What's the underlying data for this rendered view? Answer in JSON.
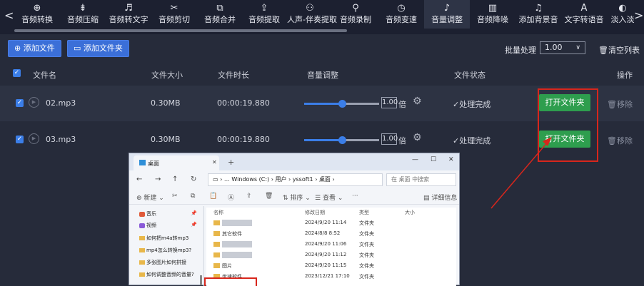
{
  "toolbar": {
    "prev_arrow": "<",
    "next_arrow": ">",
    "tools": [
      {
        "label": "音频转换",
        "icon": "convert-icon",
        "glyph": "⊕"
      },
      {
        "label": "音频压缩",
        "icon": "compress-icon",
        "glyph": "⇟"
      },
      {
        "label": "音频转文字",
        "icon": "speech-to-text-icon",
        "glyph": "♬"
      },
      {
        "label": "音频剪切",
        "icon": "scissors-icon",
        "glyph": "✂"
      },
      {
        "label": "音频合并",
        "icon": "merge-icon",
        "glyph": "⧉"
      },
      {
        "label": "音频提取",
        "icon": "extract-icon",
        "glyph": "⇪"
      },
      {
        "label": "人声-伴奏提取",
        "icon": "vocal-split-icon",
        "glyph": "⚇"
      },
      {
        "label": "音频录制",
        "icon": "microphone-icon",
        "glyph": "⚲"
      },
      {
        "label": "音频变速",
        "icon": "speed-icon",
        "glyph": "◷"
      },
      {
        "label": "音量调整",
        "icon": "volume-icon",
        "glyph": "♪"
      },
      {
        "label": "音频降噪",
        "icon": "denoise-icon",
        "glyph": "▥"
      },
      {
        "label": "添加背景音",
        "icon": "background-music-icon",
        "glyph": "♫"
      },
      {
        "label": "文字转语音",
        "icon": "text-to-speech-icon",
        "glyph": "A"
      },
      {
        "label": "淡入淡",
        "icon": "fade-icon",
        "glyph": "◐"
      }
    ],
    "active_index": 9
  },
  "actions": {
    "add_file": "添加文件",
    "add_folder": "添加文件夹",
    "batch_label": "批量处理",
    "batch_value": "1.00",
    "clear_list": "清空列表"
  },
  "table": {
    "headers": {
      "name": "文件名",
      "size": "文件大小",
      "duration": "文件时长",
      "volume": "音量调整",
      "status": "文件状态",
      "operation": "操作"
    },
    "rows": [
      {
        "name": "02.mp3",
        "size": "0.30MB",
        "duration": "00:00:19.880",
        "volume": "1.00",
        "volume_level": 0.5,
        "unit": "倍",
        "status": "处理完成",
        "open": "打开文件夹",
        "remove": "移除"
      },
      {
        "name": "03.mp3",
        "size": "0.30MB",
        "duration": "00:00:19.880",
        "volume": "1.00",
        "volume_level": 0.5,
        "unit": "倍",
        "status": "处理完成",
        "open": "打开文件夹",
        "remove": "移除"
      }
    ]
  },
  "explorer": {
    "tab_title": "桌面",
    "address": [
      "Windows (C:)",
      "用户",
      "yssoft1",
      "桌面"
    ],
    "address_dots": "…",
    "search_placeholder": "在 桌面 中搜索",
    "commands": {
      "new": "新建",
      "sort": "排序",
      "view": "查看",
      "more": "···",
      "details": "详细信息"
    },
    "sidebar": [
      {
        "label": "音乐",
        "icon": "music-icon",
        "color": "#e05a3a",
        "pinned": true
      },
      {
        "label": "视频",
        "icon": "video-icon",
        "color": "#8a5ad8",
        "pinned": true
      },
      {
        "label": "如何把m4a转mp3",
        "icon": "folder-icon",
        "pinned": false
      },
      {
        "label": "mp4怎么转换mp3?",
        "icon": "folder-icon",
        "pinned": false
      },
      {
        "label": "多张图片如何拼接",
        "icon": "folder-icon",
        "pinned": false
      },
      {
        "label": "如何调整音频的音量?",
        "icon": "folder-icon",
        "pinned": false
      }
    ],
    "columns": {
      "name": "名称",
      "modified": "修改日期",
      "type": "类型",
      "size": "大小"
    },
    "files": [
      {
        "name": "",
        "modified": "2024/9/20 11:14",
        "type": "文件夹"
      },
      {
        "name": "其它软件",
        "modified": "2024/8/8 8:52",
        "type": "文件夹"
      },
      {
        "name": "",
        "modified": "2024/9/20 11:06",
        "type": "文件夹"
      },
      {
        "name": "",
        "modified": "2024/9/20 11:12",
        "type": "文件夹"
      },
      {
        "name": "图片",
        "modified": "2024/9/20 11:15",
        "type": "文件夹"
      },
      {
        "name": "优速软件",
        "modified": "2023/12/21 17:10",
        "type": "文件夹"
      }
    ]
  }
}
